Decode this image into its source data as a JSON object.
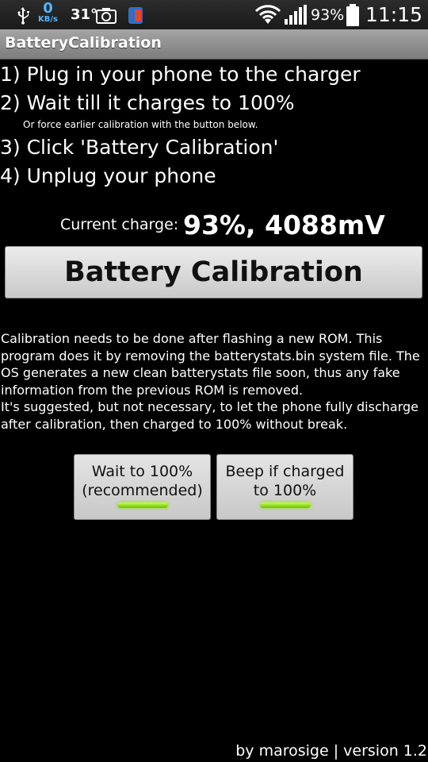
{
  "status_bar": {
    "net_speed_value": "0",
    "net_speed_unit": "KB/s",
    "temperature": "31°",
    "battery_percent": "93%",
    "time": "11:15",
    "icons": [
      "usb-icon",
      "network-speed-icon",
      "camera-icon",
      "app-notification-icon",
      "wifi-icon",
      "signal-icon",
      "battery-icon"
    ]
  },
  "app": {
    "title": "BatteryCalibration"
  },
  "steps": [
    "1) Plug in your phone to the charger",
    "2) Wait till it charges to 100%",
    "3) Click 'Battery Calibration'",
    "4) Unplug your phone"
  ],
  "hint": "Or force earlier calibration with the button below.",
  "charge": {
    "label": "Current charge:",
    "value": "93%, 4088mV"
  },
  "calibrate_button": "Battery Calibration",
  "description": [
    "Calibration needs to be done after flashing a new ROM. This program does it by removing the batterystats.bin system file. The OS generates a new clean batterystats file soon, thus any fake information from the previous ROM is removed.",
    "It's suggested, but not necessary, to let the phone fully discharge after calibration, then charged to 100% without break."
  ],
  "toggles": [
    {
      "label_line1": "Wait to 100%",
      "label_line2": "(recommended)",
      "on": true
    },
    {
      "label_line1": "Beep if charged",
      "label_line2": "to 100%",
      "on": true
    }
  ],
  "footer": "by marosige | version 1.2",
  "colors": {
    "indicator_on": "#7fd620",
    "net_speed": "#4fb6ff"
  }
}
